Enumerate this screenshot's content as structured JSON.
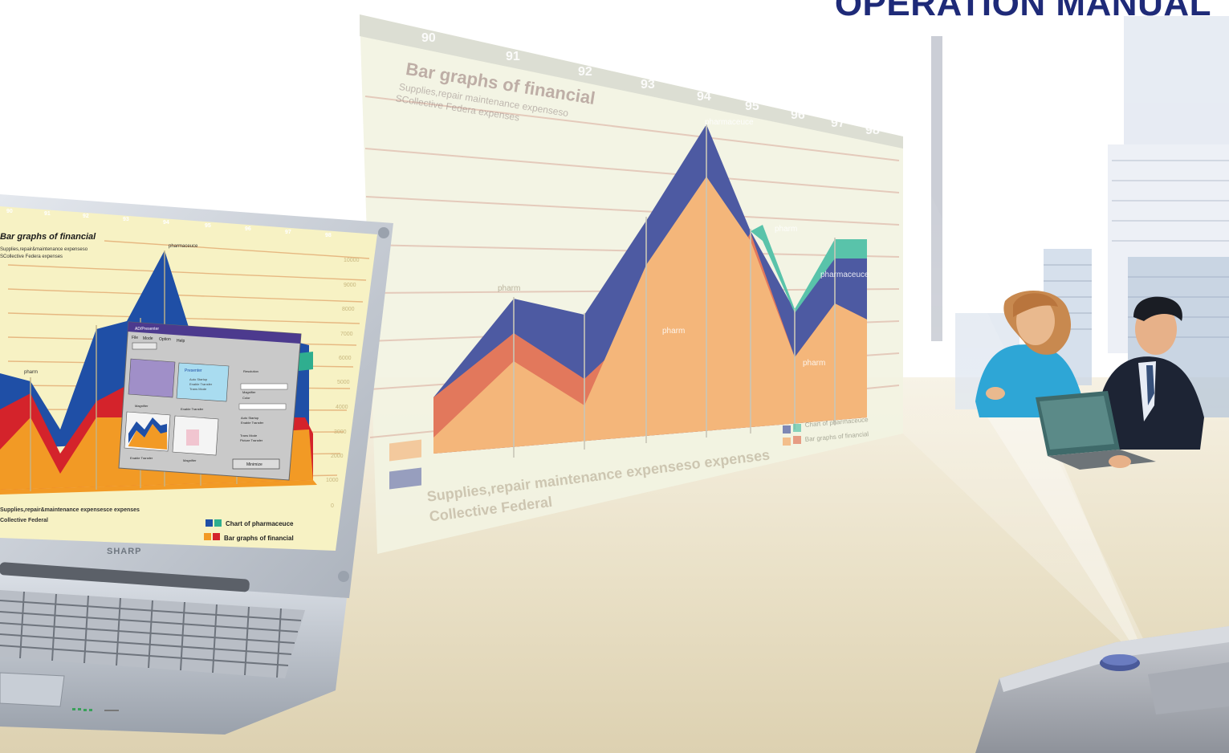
{
  "header": {
    "title": "OPERATION MANUAL"
  },
  "projection": {
    "title": "Bar graphs of financial",
    "subtitle_1": "Supplies,repair maintenance expenseso",
    "subtitle_2": "SCollective Federa expenses",
    "year_ticks": [
      "90",
      "91",
      "92",
      "93",
      "94",
      "95",
      "96",
      "97",
      "98"
    ],
    "annotations": [
      "pharmaceuce",
      "pharm",
      "pharm",
      "pharmaceuce",
      "pharm",
      "pharm"
    ],
    "footer_1": "Supplies,repair maintenance expenseso   expenses",
    "footer_2": "Collective Federal",
    "legend": [
      "Chart of pharmaceuce",
      "Bar graphs of financial"
    ],
    "colors": {
      "blue": "#4d5aa2",
      "orange": "#f4b67a",
      "salmon": "#e2785c",
      "teal": "#59c3aa",
      "screen": "#f2f3e2"
    }
  },
  "laptop": {
    "brand": "SHARP",
    "chart_title": "Bar graphs of financial",
    "chart_subtitle_1": "Supplies,repair&maintenance expenseso",
    "chart_subtitle_2": "SCollective Federa expenses",
    "year_ticks": [
      "90",
      "91",
      "92",
      "93",
      "94",
      "95",
      "96",
      "97",
      "98"
    ],
    "y_ticks": [
      "10000",
      "9000",
      "8000",
      "7000",
      "6000",
      "5000",
      "4000",
      "3000",
      "2000",
      "1000",
      "0"
    ],
    "annotations": [
      "pharmaceuce",
      "pharm"
    ],
    "footer_1": "Supplies,repair&maintenance expensesce   expenses",
    "footer_2": "Collective Federal",
    "legend": [
      "Chart of pharmaceuce",
      "Bar graphs of financial"
    ],
    "dialog": {
      "title": "AD/Presenter",
      "menu": [
        "File",
        "Mode",
        "Option",
        "Help"
      ],
      "left_labels": [
        "Magnifier",
        "Enable Transfer"
      ],
      "panel_title": "Presenter",
      "panel_lines": [
        "Auto Startup",
        "Enable Transfer",
        "Trans Mode"
      ],
      "right_labels": [
        "Resolution",
        "Magnifier",
        "Color",
        "Auto Startup",
        "Enable Transfer",
        "Trans Mode",
        "Picture Transfer"
      ],
      "bottom_labels": [
        "Enable Transfer",
        "Magnifier"
      ],
      "button": "Minimize"
    },
    "colors": {
      "blue": "#1f4fa6",
      "orange": "#f29a25",
      "red": "#d4232b",
      "teal": "#2fae8f",
      "screen": "#f7f2c4",
      "bezel": "#cfd4dc"
    }
  }
}
